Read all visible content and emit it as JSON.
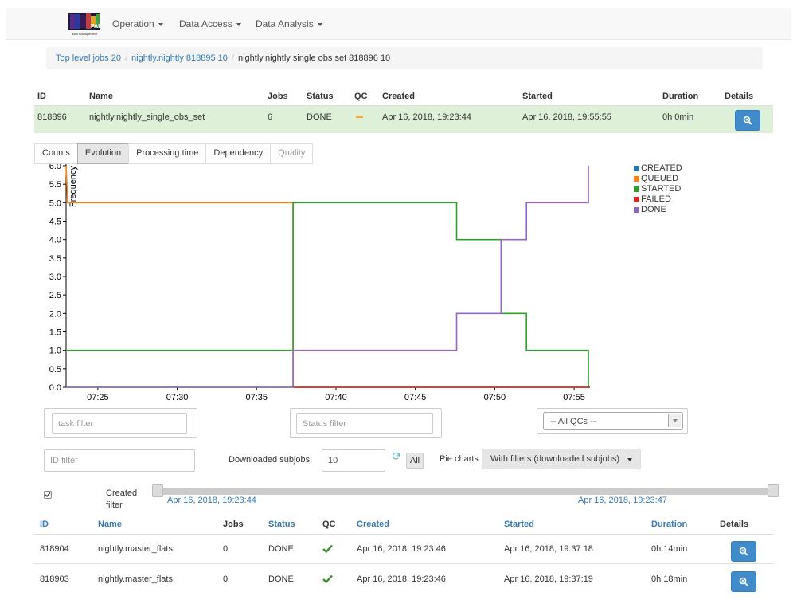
{
  "nav": {
    "items": [
      {
        "label": "Operation"
      },
      {
        "label": "Data Access"
      },
      {
        "label": "Data Analysis"
      }
    ]
  },
  "breadcrumb": {
    "items": [
      "Top level jobs 20",
      "nightly.nightly 818895 10"
    ],
    "active": "nightly.nightly single obs set 818896 10"
  },
  "job_table": {
    "headers": [
      "ID",
      "Name",
      "Jobs",
      "Status",
      "QC",
      "Created",
      "Started",
      "Duration",
      "Details"
    ],
    "row": {
      "id": "818896",
      "name": "nightly.nightly_single_obs_set",
      "jobs": "6",
      "status": "DONE",
      "qc": "warning",
      "created": "Apr 16, 2018, 19:23:44",
      "started": "Apr 16, 2018, 19:55:55",
      "duration": "0h 0min"
    }
  },
  "tabs": [
    {
      "label": "Counts",
      "state": "normal"
    },
    {
      "label": "Evolution",
      "state": "active"
    },
    {
      "label": "Processing time",
      "state": "normal"
    },
    {
      "label": "Dependency",
      "state": "normal"
    },
    {
      "label": "Quality",
      "state": "disabled"
    }
  ],
  "chart_data": {
    "type": "line",
    "ylabel": "Frequency",
    "ylim": [
      0,
      6.0
    ],
    "xlim": [
      "07:23",
      "07:56"
    ],
    "yticks": [
      "0.0",
      "0.5",
      "1.0",
      "1.5",
      "2.0",
      "2.5",
      "3.0",
      "3.5",
      "4.0",
      "4.5",
      "5.0",
      "5.5",
      "6.0"
    ],
    "xticks": [
      "07:25",
      "07:30",
      "07:35",
      "07:40",
      "07:45",
      "07:50",
      "07:55"
    ],
    "legend_position": "top-right",
    "series": [
      {
        "name": "CREATED",
        "color": "#1f77b4",
        "steps": [
          [
            "07:23",
            0
          ],
          [
            "07:56",
            0
          ]
        ]
      },
      {
        "name": "QUEUED",
        "color": "#ff7f0e",
        "steps": [
          [
            "07:23",
            6
          ],
          [
            "07:23.1",
            5
          ],
          [
            "07:37.3",
            5
          ],
          [
            "07:37.3",
            0
          ],
          [
            "07:56",
            0
          ]
        ]
      },
      {
        "name": "STARTED",
        "color": "#2ca02c",
        "steps": [
          [
            "07:23",
            1
          ],
          [
            "07:37.3",
            1
          ],
          [
            "07:37.3",
            5
          ],
          [
            "07:47.6",
            5
          ],
          [
            "07:47.6",
            4
          ],
          [
            "07:50.4",
            4
          ],
          [
            "07:50.4",
            2
          ],
          [
            "07:52",
            2
          ],
          [
            "07:52",
            1
          ],
          [
            "07:55.9",
            1
          ],
          [
            "07:55.9",
            0
          ]
        ]
      },
      {
        "name": "FAILED",
        "color": "#d62728",
        "steps": [
          [
            "07:37.3",
            0
          ],
          [
            "07:56",
            0
          ]
        ]
      },
      {
        "name": "DONE",
        "color": "#9467bd",
        "steps": [
          [
            "07:23",
            0
          ],
          [
            "07:37.3",
            0
          ],
          [
            "07:37.3",
            1
          ],
          [
            "07:47.6",
            1
          ],
          [
            "07:47.6",
            2
          ],
          [
            "07:50.4",
            2
          ],
          [
            "07:50.4",
            4
          ],
          [
            "07:52",
            4
          ],
          [
            "07:52",
            5
          ],
          [
            "07:55.9",
            5
          ],
          [
            "07:55.9",
            6
          ]
        ]
      }
    ]
  },
  "filters": {
    "task_placeholder": "task filter",
    "status_placeholder": "Status filter",
    "qc_select": "-- All QCs --",
    "id_placeholder": "ID filter",
    "downloaded_label": "Downloaded subjobs:",
    "downloaded_value": "10",
    "all_button": "All",
    "pie_label": "Pie charts",
    "pie_select": "With filters (downloaded subjobs)"
  },
  "created_filter": {
    "label_line1": "Created",
    "label_line2": "filter",
    "start": "Apr 16, 2018, 19:23:44",
    "end": "Apr 16, 2018, 19:23:47"
  },
  "subjobs": {
    "headers": [
      "ID",
      "Name",
      "Jobs",
      "Status",
      "QC",
      "Created",
      "Started",
      "Duration",
      "Details"
    ],
    "rows": [
      {
        "id": "818904",
        "name": "nightly.master_flats",
        "jobs": "0",
        "status": "DONE",
        "qc": "ok",
        "created": "Apr 16, 2018, 19:23:46",
        "started": "Apr 16, 2018, 19:37:18",
        "duration": "0h 14min"
      },
      {
        "id": "818903",
        "name": "nightly.master_flats",
        "jobs": "0",
        "status": "DONE",
        "qc": "ok",
        "created": "Apr 16, 2018, 19:23:46",
        "started": "Apr 16, 2018, 19:37:19",
        "duration": "0h 18min"
      }
    ]
  },
  "colors": {
    "accent": "#337ab7",
    "success_row": "#dff0d8",
    "qc_ok": "#3c8d2f",
    "qc_warning": "#f0ad4e"
  }
}
